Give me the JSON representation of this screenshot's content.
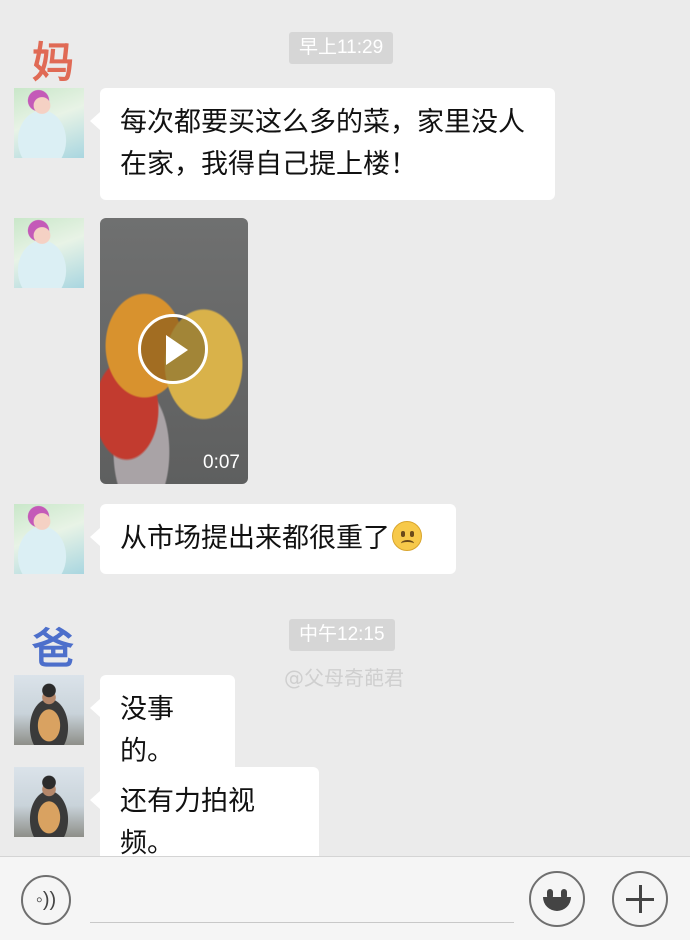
{
  "speakers": {
    "mom_label": "妈",
    "mom_color": "#e06a55",
    "dad_label": "爸",
    "dad_color": "#4d6fcb"
  },
  "timestamps": [
    "早上11:29",
    "中午12:15"
  ],
  "watermark": "@父母奇葩君",
  "messages": [
    {
      "sender": "mom",
      "type": "text",
      "lines": [
        "每次都要买这么多的菜，家里没人",
        "在家，我得自己提上楼！"
      ]
    },
    {
      "sender": "mom",
      "type": "video",
      "duration": "0:07",
      "icon": "play-icon"
    },
    {
      "sender": "mom",
      "type": "text",
      "text": "从市场提出来都很重了",
      "emoji": "frown-emoji"
    },
    {
      "sender": "dad",
      "type": "text",
      "text": "没事的。"
    },
    {
      "sender": "dad",
      "type": "text",
      "text": "还有力拍视频。"
    }
  ],
  "input_bar": {
    "voice_icon": "voice-icon",
    "emoji_icon": "emoji-icon",
    "plus_icon": "plus-icon",
    "voice_glyph": "◦))"
  }
}
